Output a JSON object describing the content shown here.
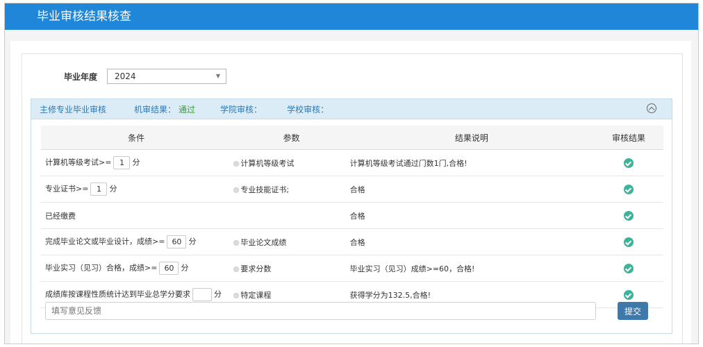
{
  "header": {
    "title": "毕业审核结果核查"
  },
  "year": {
    "label": "毕业年度",
    "value": "2024"
  },
  "panel": {
    "title": "主修专业毕业审核",
    "machine_label": "机审结果：",
    "machine_value": "通过",
    "college_label": "学院审核：",
    "school_label": "学校审核："
  },
  "table": {
    "headers": {
      "condition": "条件",
      "param": "参数",
      "desc": "结果说明",
      "result": "审核结果"
    },
    "rows": [
      {
        "pre": "计算机等级考试>=",
        "value": "1",
        "post": "分",
        "param": "计算机等级考试",
        "desc": "计算机等级考试通过门数1门,合格!"
      },
      {
        "pre": "专业证书>=",
        "value": "1",
        "post": "分",
        "param": "专业技能证书;",
        "desc": "合格"
      },
      {
        "pre": "已经缴费",
        "value": "",
        "post": "",
        "param": "",
        "desc": "合格"
      },
      {
        "pre": "完成毕业论文或毕业设计，成绩>=",
        "value": "60",
        "post": "分",
        "param": "毕业论文成绩",
        "desc": "合格"
      },
      {
        "pre": "毕业实习（见习）合格，成绩>=",
        "value": "60",
        "post": "分",
        "param": "要求分数",
        "desc": "毕业实习（见习）成绩>=60，合格!"
      },
      {
        "pre": "成绩库按课程性质统计达到毕业总学分要求",
        "value": "",
        "post": "分",
        "param": "特定课程",
        "desc": "获得学分为132.5,合格!"
      }
    ]
  },
  "feedback": {
    "placeholder": "填写意见反馈",
    "submit_label": "提交"
  },
  "colors": {
    "header_bg": "#1f86d8",
    "panel_header_bg": "#dbecf6",
    "pass": "#3c9a3c",
    "check": "#3fb39a",
    "submit_bg": "#3f79aa"
  }
}
